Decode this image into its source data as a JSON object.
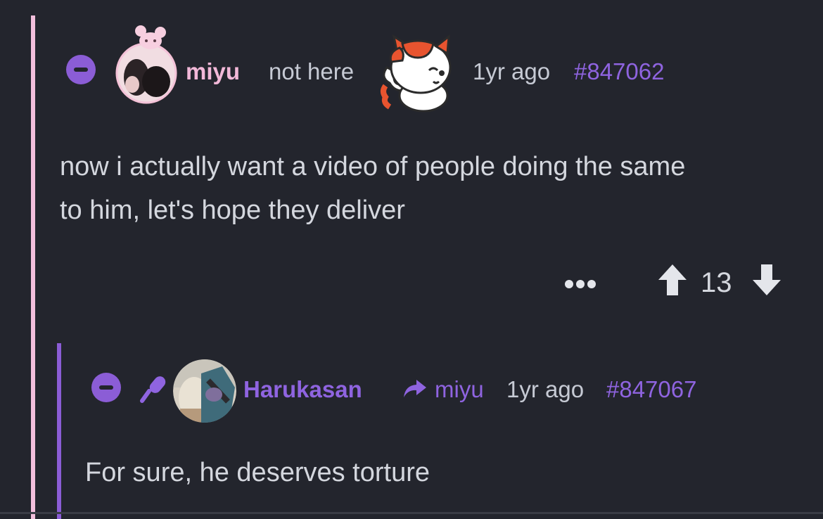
{
  "colors": {
    "background": "#23252d",
    "accent_purple": "#8f64e0",
    "miyu_name": "#f2b8d8",
    "outer_thread_line": "#f2bfdc",
    "inner_thread_line": "#8b5dd6",
    "text": "#d4d7de"
  },
  "comment": {
    "username": "miyu",
    "status": "not here",
    "time": "1yr ago",
    "id": "#847062",
    "body_line1": "now i actually want a video of people doing the same",
    "body_line2": "to him, let's hope they deliver",
    "votes": "13",
    "icons": [
      "collapse-icon",
      "avatar",
      "waving-cat-sticker",
      "more-dots-icon",
      "upvote-arrow-icon",
      "downvote-arrow-icon"
    ]
  },
  "reply": {
    "username": "Harukasan",
    "reply_to": "miyu",
    "time": "1yr ago",
    "id": "#847067",
    "body": "For sure, he deserves torture",
    "icons": [
      "collapse-icon",
      "microphone-icon",
      "avatar",
      "reply-arrow-icon"
    ]
  }
}
